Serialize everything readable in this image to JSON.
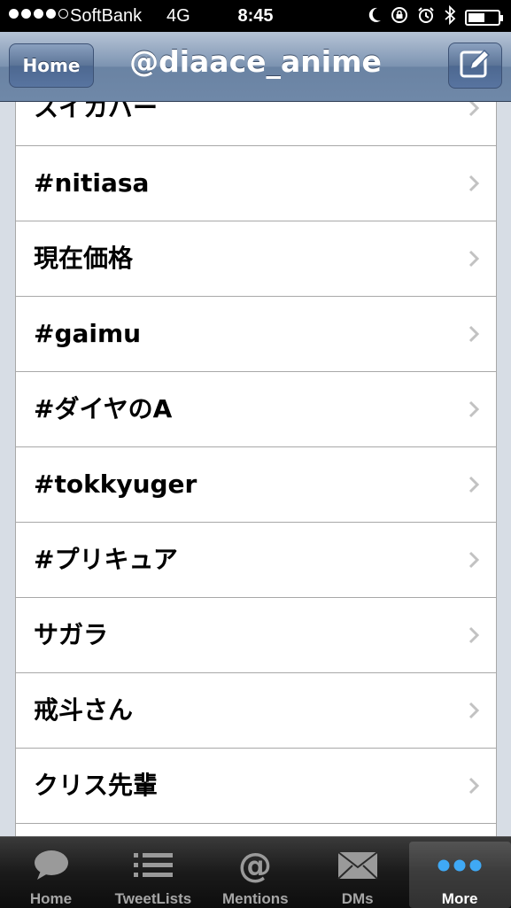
{
  "status_bar": {
    "signal_bars_filled": 4,
    "carrier": "SoftBank",
    "network": "4G",
    "time": "8:45",
    "icons": [
      "moon-icon",
      "rotation-lock-icon",
      "alarm-icon",
      "bluetooth-icon",
      "battery-icon"
    ],
    "battery_level": 0.55
  },
  "nav_bar": {
    "back_label": "Home",
    "title": "@diaace_anime",
    "compose_icon": "compose-icon"
  },
  "list": {
    "items": [
      {
        "label": "スイカバー"
      },
      {
        "label": "#nitiasa"
      },
      {
        "label": "現在価格"
      },
      {
        "label": "#gaimu"
      },
      {
        "label": "#ダイヤのA"
      },
      {
        "label": "#tokkyuger"
      },
      {
        "label": "#プリキュア"
      },
      {
        "label": "サガラ"
      },
      {
        "label": "戒斗さん"
      },
      {
        "label": "クリス先輩"
      },
      {
        "label": ""
      }
    ]
  },
  "tab_bar": {
    "tabs": [
      {
        "label": "Home",
        "icon": "speech-bubble-icon",
        "active": false
      },
      {
        "label": "TweetLists",
        "icon": "list-icon",
        "active": false
      },
      {
        "label": "Mentions",
        "icon": "at-sign-icon",
        "active": false
      },
      {
        "label": "DMs",
        "icon": "envelope-icon",
        "active": false
      },
      {
        "label": "More",
        "icon": "more-dots-icon",
        "active": true
      }
    ]
  },
  "colors": {
    "nav_bar": "#7c93b1",
    "background": "#d7dde5",
    "more_dots": "#3fa9f5"
  }
}
